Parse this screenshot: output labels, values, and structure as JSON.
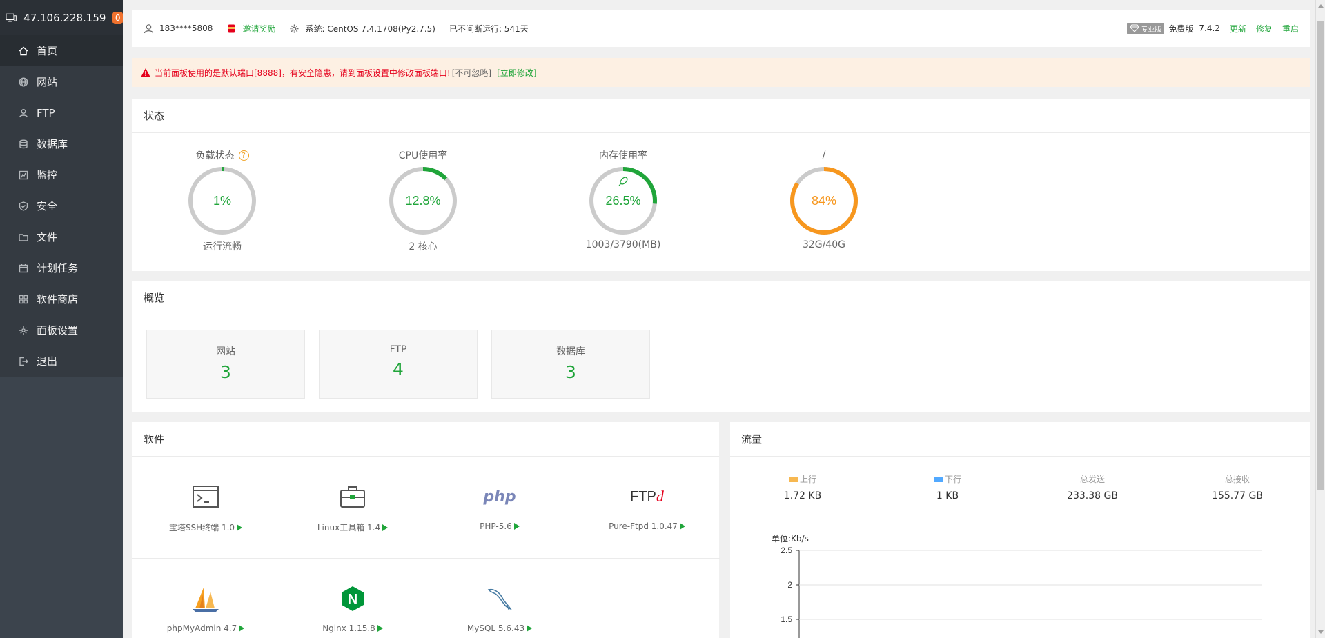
{
  "sidebar": {
    "ip": "47.106.228.159",
    "badge": "0",
    "items": [
      {
        "label": "首页"
      },
      {
        "label": "网站"
      },
      {
        "label": "FTP"
      },
      {
        "label": "数据库"
      },
      {
        "label": "监控"
      },
      {
        "label": "安全"
      },
      {
        "label": "文件"
      },
      {
        "label": "计划任务"
      },
      {
        "label": "软件商店"
      },
      {
        "label": "面板设置"
      },
      {
        "label": "退出"
      }
    ]
  },
  "topbar": {
    "user": "183****5808",
    "invite": "邀请奖励",
    "system": "系统:  CentOS 7.4.1708(Py2.7.5)",
    "uptime": "已不间断运行: 541天",
    "pro": "专业版",
    "edition": "免费版",
    "version": "7.4.2",
    "update": "更新",
    "repair": "修复",
    "restart": "重启"
  },
  "alert": {
    "message": "当前面板使用的是默认端口[8888]，有安全隐患，请到面板设置中修改面板端口!",
    "ignore": "[不可忽略]",
    "fix": "[立即修改]"
  },
  "status": {
    "title": "状态",
    "gauges": [
      {
        "label": "负载状态",
        "value": "1%",
        "percent": 1,
        "sub": "运行流畅",
        "color": "#20a53a",
        "help": "?"
      },
      {
        "label": "CPU使用率",
        "value": "12.8%",
        "percent": 12.8,
        "sub": "2 核心",
        "color": "#20a53a"
      },
      {
        "label": "内存使用率",
        "value": "26.5%",
        "percent": 26.5,
        "sub": "1003/3790(MB)",
        "color": "#20a53a"
      },
      {
        "label": "/",
        "value": "84%",
        "percent": 84,
        "sub": "32G/40G",
        "color": "#f7971e"
      }
    ]
  },
  "overview": {
    "title": "概览",
    "cards": [
      {
        "label": "网站",
        "value": "3"
      },
      {
        "label": "FTP",
        "value": "4"
      },
      {
        "label": "数据库",
        "value": "3"
      }
    ]
  },
  "software": {
    "title": "软件",
    "items": [
      {
        "label": "宝塔SSH终端 1.0",
        "icon": "terminal-icon"
      },
      {
        "label": "Linux工具箱 1.4",
        "icon": "toolbox-icon"
      },
      {
        "label": "PHP-5.6",
        "icon": "php-icon"
      },
      {
        "label": "Pure-Ftpd 1.0.47",
        "icon": "ftp-icon"
      },
      {
        "label": "phpMyAdmin 4.7",
        "icon": "phpmyadmin-icon"
      },
      {
        "label": "Nginx 1.15.8",
        "icon": "nginx-icon"
      },
      {
        "label": "MySQL 5.6.43",
        "icon": "mysql-icon"
      }
    ],
    "php_logo": "php",
    "ftp_logo": "FTP",
    "ftp_logo_d": "d",
    "nginx_logo": "N"
  },
  "traffic": {
    "title": "流量",
    "up_label": "上行",
    "down_label": "下行",
    "up_color": "#f7b851",
    "down_color": "#52a9ff",
    "up_value": "1.72 KB",
    "down_value": "1 KB",
    "sent_label": "总发送",
    "sent_value": "233.38 GB",
    "recv_label": "总接收",
    "recv_value": "155.77 GB",
    "unit": "单位:Kb/s"
  },
  "chart_data": {
    "type": "line",
    "ylabel": "单位:Kb/s",
    "y_ticks": [
      "2.5",
      "2",
      "1.5"
    ],
    "ylim": [
      1.5,
      2.5
    ],
    "grid": true
  }
}
